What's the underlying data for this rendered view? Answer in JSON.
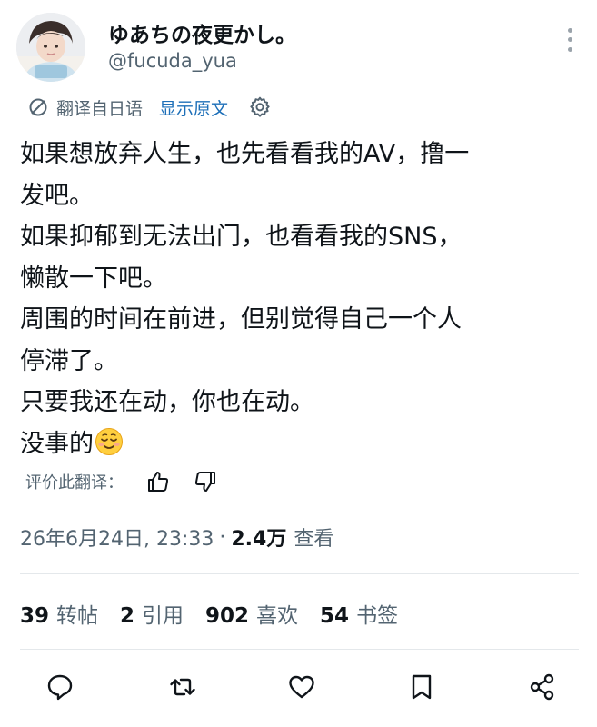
{
  "author": {
    "display_name": "ゆあちの夜更かし。",
    "handle": "@fucuda_yua"
  },
  "translation": {
    "label": "翻译自日语",
    "show_original": "显示原文"
  },
  "post": {
    "lines": [
      "如果想放弃人生，也先看看我的AV，撸一",
      "发吧。",
      "如果抑郁到无法出门，也看看我的SNS，",
      "懒散一下吧。",
      "周围的时间在前进，但别觉得自己一个人",
      "停滞了。",
      "只要我还在动，你也在动。",
      "没事的"
    ],
    "emoji": "smiling-face-emoji"
  },
  "rate": {
    "label": "评价此翻译："
  },
  "meta": {
    "date": "26年6月24日, 23:33",
    "separator": "·",
    "views_count": "2.4万",
    "views_label": "查看"
  },
  "stats": [
    {
      "num": "39",
      "label": "转帖"
    },
    {
      "num": "2",
      "label": "引用"
    },
    {
      "num": "902",
      "label": "喜欢"
    },
    {
      "num": "54",
      "label": "书签"
    }
  ],
  "icons": {
    "reply": "reply-icon",
    "repost": "repost-icon",
    "like": "heart-icon",
    "bookmark": "bookmark-icon",
    "share": "share-icon",
    "more": "more-icon",
    "translate": "translate-icon",
    "settings": "gear-icon",
    "thumb_up": "thumbs-up-icon",
    "thumb_down": "thumbs-down-icon"
  },
  "colors": {
    "text": "#0f1419",
    "secondary": "#536471",
    "link": "#1d6fb8"
  }
}
